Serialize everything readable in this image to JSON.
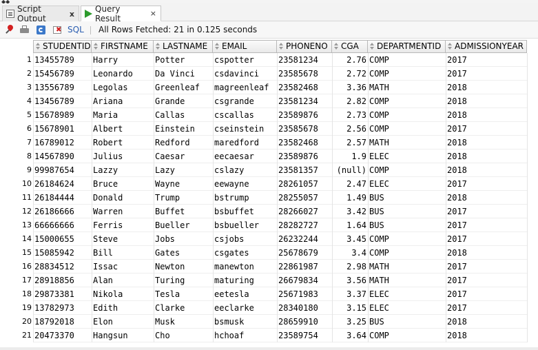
{
  "window": {
    "corner_glyph": "◆◆"
  },
  "tabs": [
    {
      "label": "Script Output",
      "close": "x",
      "active": false
    },
    {
      "label": "Query Result",
      "close": "×",
      "active": true
    }
  ],
  "toolbar": {
    "sql_label": "SQL",
    "separator": "|",
    "status": "All Rows Fetched: 21 in 0.125 seconds"
  },
  "grid": {
    "columns": [
      "STUDENTID",
      "FIRSTNAME",
      "LASTNAME",
      "EMAIL",
      "PHONENO",
      "CGA",
      "DEPARTMENTID",
      "ADMISSIONYEAR"
    ],
    "rows": [
      [
        "1",
        "13455789",
        "Harry",
        "Potter",
        "cspotter",
        "23581234",
        "2.76",
        "COMP",
        "2017"
      ],
      [
        "2",
        "15456789",
        "Leonardo",
        "Da Vinci",
        "csdavinci",
        "23585678",
        "2.72",
        "COMP",
        "2017"
      ],
      [
        "3",
        "13556789",
        "Legolas",
        "Greenleaf",
        "magreenleaf",
        "23582468",
        "3.36",
        "MATH",
        "2018"
      ],
      [
        "4",
        "13456789",
        "Ariana",
        "Grande",
        "csgrande",
        "23581234",
        "2.82",
        "COMP",
        "2018"
      ],
      [
        "5",
        "15678989",
        "Maria",
        "Callas",
        "cscallas",
        "23589876",
        "2.73",
        "COMP",
        "2018"
      ],
      [
        "6",
        "15678901",
        "Albert",
        "Einstein",
        "cseinstein",
        "23585678",
        "2.56",
        "COMP",
        "2017"
      ],
      [
        "7",
        "16789012",
        "Robert",
        "Redford",
        "maredford",
        "23582468",
        "2.57",
        "MATH",
        "2018"
      ],
      [
        "8",
        "14567890",
        "Julius",
        "Caesar",
        "eecaesar",
        "23589876",
        "1.9",
        "ELEC",
        "2018"
      ],
      [
        "9",
        "99987654",
        "Lazzy",
        "Lazy",
        "cslazy",
        "23581357",
        "(null)",
        "COMP",
        "2018"
      ],
      [
        "10",
        "26184624",
        "Bruce",
        "Wayne",
        "eewayne",
        "28261057",
        "2.47",
        "ELEC",
        "2017"
      ],
      [
        "11",
        "26184444",
        "Donald",
        "Trump",
        "bstrump",
        "28255057",
        "1.49",
        "BUS",
        "2018"
      ],
      [
        "12",
        "26186666",
        "Warren",
        "Buffet",
        "bsbuffet",
        "28266027",
        "3.42",
        "BUS",
        "2017"
      ],
      [
        "13",
        "66666666",
        "Ferris",
        "Bueller",
        "bsbueller",
        "28282727",
        "1.64",
        "BUS",
        "2017"
      ],
      [
        "14",
        "15000655",
        "Steve",
        "Jobs",
        "csjobs",
        "26232244",
        "3.45",
        "COMP",
        "2017"
      ],
      [
        "15",
        "15085942",
        "Bill",
        "Gates",
        "csgates",
        "25678679",
        "3.4",
        "COMP",
        "2018"
      ],
      [
        "16",
        "28834512",
        "Issac",
        "Newton",
        "manewton",
        "22861987",
        "2.98",
        "MATH",
        "2017"
      ],
      [
        "17",
        "28918856",
        "Alan",
        "Turing",
        "maturing",
        "26679834",
        "3.56",
        "MATH",
        "2017"
      ],
      [
        "18",
        "29873381",
        "Nikola",
        "Tesla",
        "eetesla",
        "25671983",
        "3.37",
        "ELEC",
        "2017"
      ],
      [
        "19",
        "13782973",
        "Edith",
        "Clarke",
        "eeclarke",
        "28340180",
        "3.15",
        "ELEC",
        "2017"
      ],
      [
        "20",
        "18792018",
        "Elon",
        "Musk",
        "bsmusk",
        "28659910",
        "3.25",
        "BUS",
        "2018"
      ],
      [
        "21",
        "20473370",
        "Hangsun",
        "Cho",
        "hchoaf",
        "23589754",
        "3.64",
        "COMP",
        "2018"
      ]
    ]
  }
}
